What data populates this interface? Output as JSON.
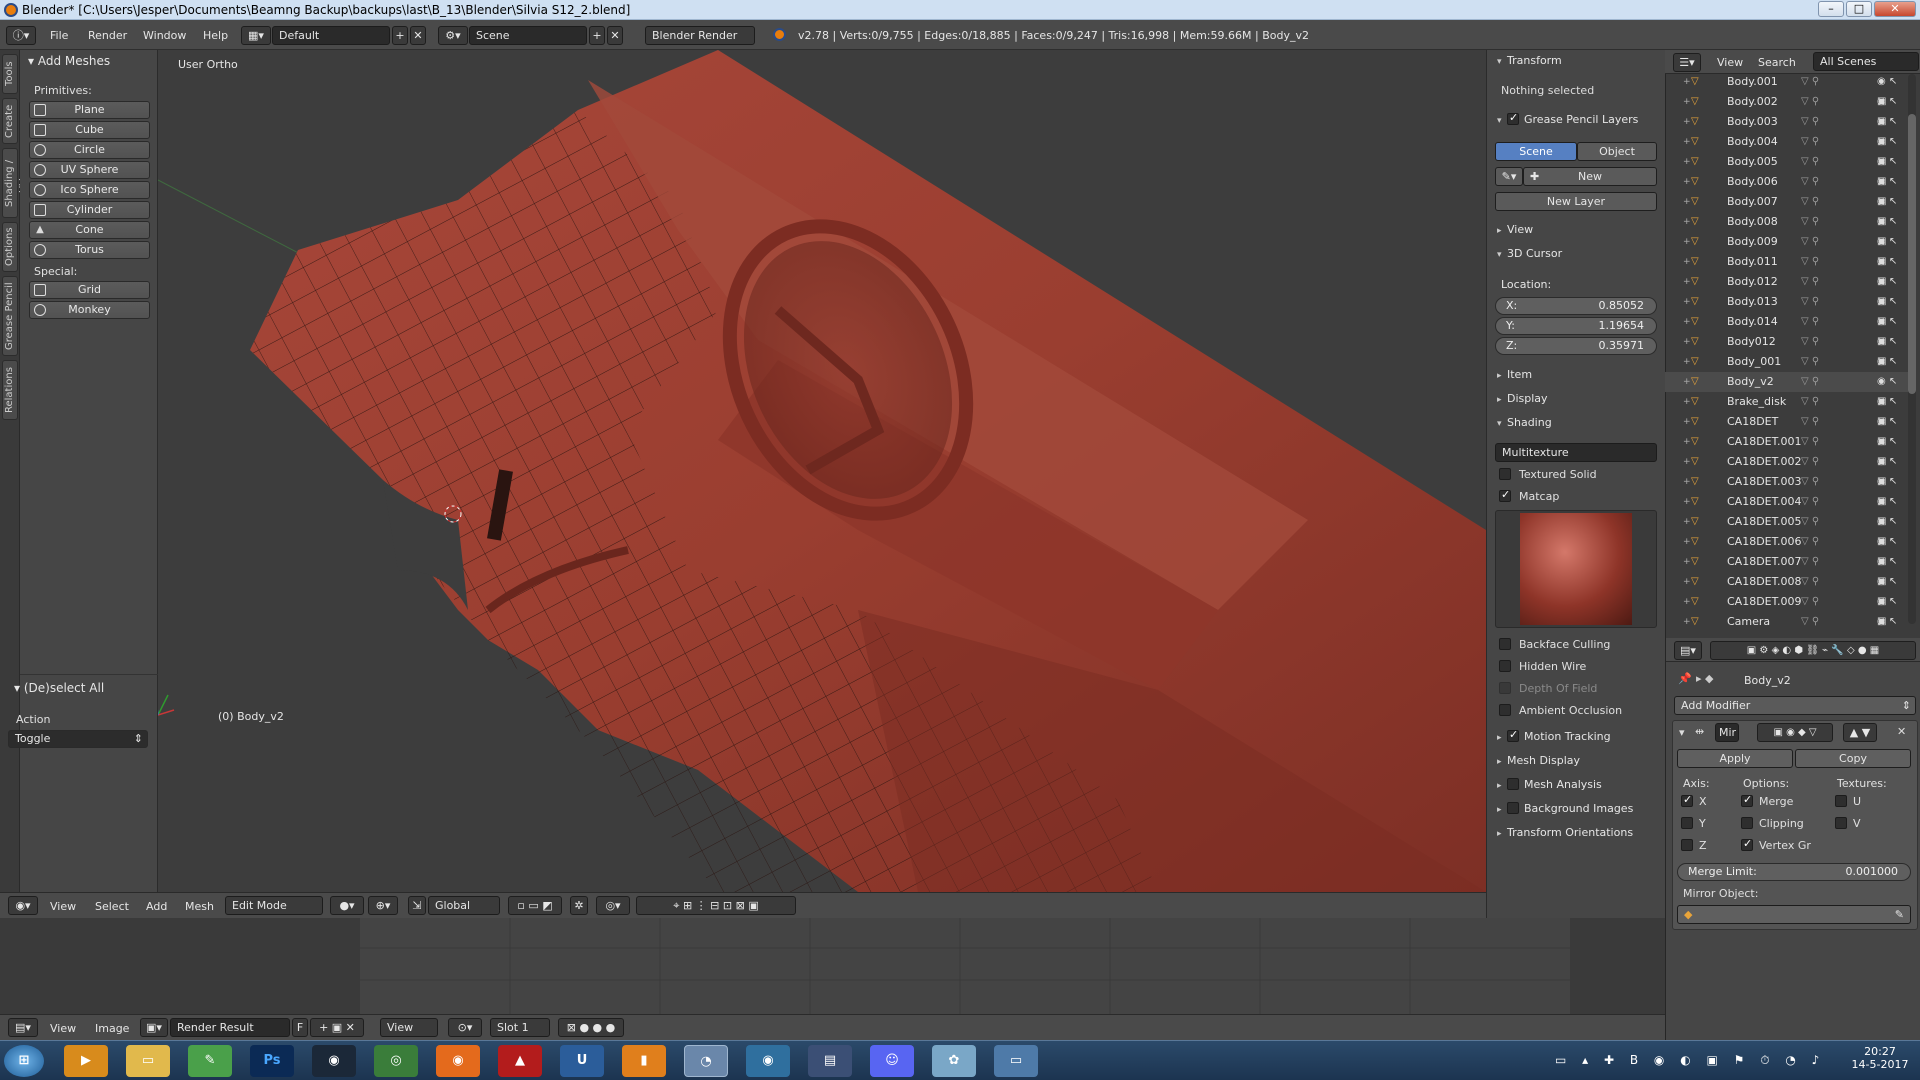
{
  "window": {
    "title": "Blender* [C:\\Users\\Jesper\\Documents\\Beamng Backup\\backups\\last\\B_13\\Blender\\Silvia S12_2.blend]"
  },
  "topbar": {
    "menus": [
      "File",
      "Render",
      "Window",
      "Help"
    ],
    "layout": "Default",
    "scene": "Scene",
    "engine": "Blender Render",
    "stats": "v2.78 | Verts:0/9,755 | Edges:0/18,885 | Faces:0/9,247 | Tris:16,998 | Mem:59.66M | Body_v2"
  },
  "tool_tabs": [
    "Tools",
    "Create",
    "Shading / UVs",
    "Options",
    "Grease Pencil",
    "Relations"
  ],
  "toolshelf": {
    "panel_title": "Add Meshes",
    "primitives_label": "Primitives:",
    "primitives": [
      "Plane",
      "Cube",
      "Circle",
      "UV Sphere",
      "Ico Sphere",
      "Cylinder",
      "Cone",
      "Torus"
    ],
    "special_label": "Special:",
    "special": [
      "Grid",
      "Monkey"
    ],
    "operator_title": "(De)select All",
    "action_label": "Action",
    "action_value": "Toggle"
  },
  "viewport": {
    "view_name": "User Ortho",
    "object_label": "(0) Body_v2"
  },
  "viewport_header": {
    "menus": [
      "View",
      "Select",
      "Add",
      "Mesh"
    ],
    "mode": "Edit Mode",
    "orientation": "Global"
  },
  "npanel": {
    "transform": "Transform",
    "nothing_selected": "Nothing selected",
    "grease_pencil_layers": "Grease Pencil Layers",
    "scene_tab": "Scene",
    "object_tab": "Object",
    "new_button": "New",
    "new_layer_button": "New Layer",
    "view": "View",
    "cursor_3d": "3D Cursor",
    "location_label": "Location:",
    "x_label": "X:",
    "x_value": "0.85052",
    "y_label": "Y:",
    "y_value": "1.19654",
    "z_label": "Z:",
    "z_value": "0.35971",
    "item": "Item",
    "display": "Display",
    "shading": "Shading",
    "shading_mode": "Multitexture",
    "textured_solid": "Textured Solid",
    "matcap": "Matcap",
    "backface_culling": "Backface Culling",
    "hidden_wire": "Hidden Wire",
    "depth_of_field": "Depth Of Field",
    "ambient_occlusion": "Ambient Occlusion",
    "motion_tracking": "Motion Tracking",
    "mesh_display": "Mesh Display",
    "mesh_analysis": "Mesh Analysis",
    "background_images": "Background Images",
    "transform_orientations": "Transform Orientations"
  },
  "outliner": {
    "view_menu": "View",
    "search_menu": "Search",
    "filter": "All Scenes",
    "items": [
      "Body.001",
      "Body.002",
      "Body.003",
      "Body.004",
      "Body.005",
      "Body.006",
      "Body.007",
      "Body.008",
      "Body.009",
      "Body.011",
      "Body.012",
      "Body.013",
      "Body.014",
      "Body012",
      "Body_001",
      "Body_v2",
      "Brake_disk",
      "CA18DET",
      "CA18DET.001",
      "CA18DET.002",
      "CA18DET.003",
      "CA18DET.004",
      "CA18DET.005",
      "CA18DET.006",
      "CA18DET.007",
      "CA18DET.008",
      "CA18DET.009",
      "Camera"
    ]
  },
  "properties": {
    "object_name": "Body_v2",
    "add_modifier": "Add Modifier",
    "modifier_name": "Mir",
    "apply": "Apply",
    "copy": "Copy",
    "axis_label": "Axis:",
    "options_label": "Options:",
    "textures_label": "Textures:",
    "axis_x": "X",
    "axis_y": "Y",
    "axis_z": "Z",
    "merge": "Merge",
    "clipping": "Clipping",
    "vertex_groups": "Vertex Gr",
    "tex_u": "U",
    "tex_v": "V",
    "merge_limit_label": "Merge Limit:",
    "merge_limit_value": "0.001000",
    "mirror_object_label": "Mirror Object:"
  },
  "image_header": {
    "menus": [
      "View",
      "Image"
    ],
    "image_name": "Render Result",
    "f_button": "F",
    "view": "View",
    "slot": "Slot 1"
  },
  "taskbar": {
    "time": "20:27",
    "date": "14-5-2017"
  },
  "colors": {
    "mesh": "#9a3e30",
    "accent_blue": "#5680c2",
    "blender_orange": "#e87d0d"
  }
}
